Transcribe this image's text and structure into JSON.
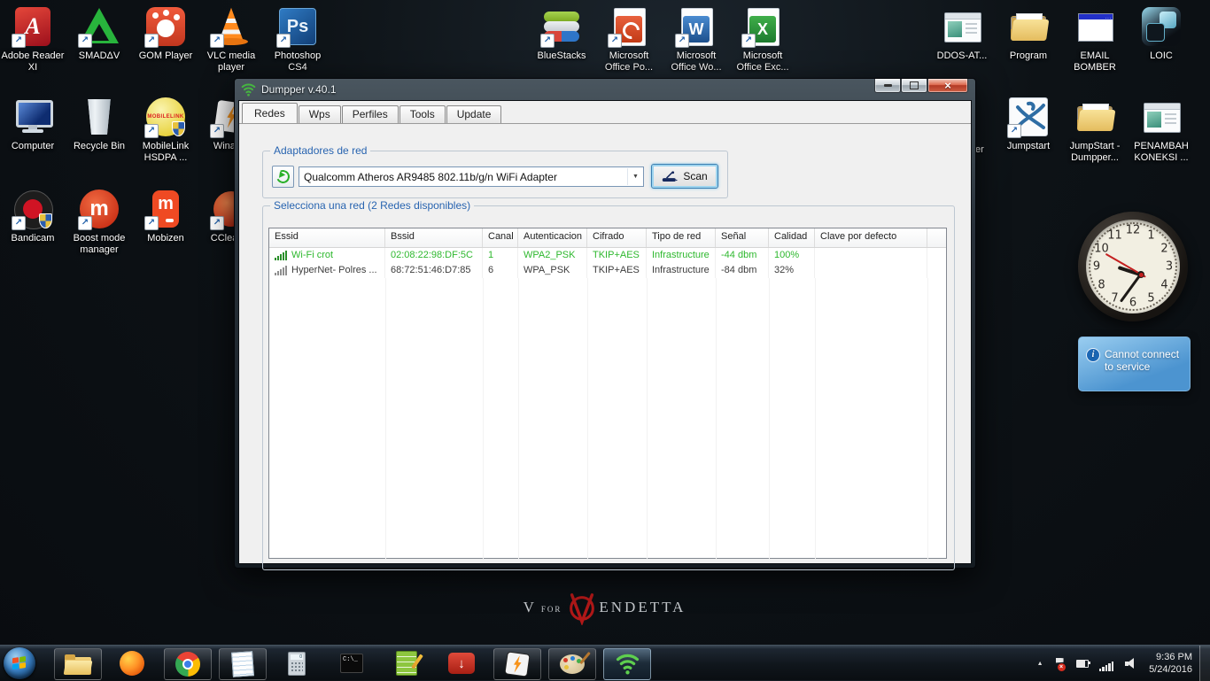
{
  "icons": {
    "shortcut_arrow": "↗",
    "adobe_glyph": "A",
    "photoshop_glyph": "Ps",
    "word_glyph": "W",
    "excel_glyph": "X",
    "boost_glyph": "m",
    "mobizen_glyph": "m",
    "cmd_glyph": "C:\\_",
    "calc_zero": "0",
    "download_arrow": "↓",
    "dropdown_arrow": "▼",
    "tray_expand": "▲",
    "info": "i",
    "close": "×",
    "email_dots": "...",
    "mobilelink_text": "MOBILELINK"
  },
  "desktop": {
    "icons": [
      {
        "label": "Adobe Reader XI"
      },
      {
        "label": "SMADΔV"
      },
      {
        "label": "GOM Player"
      },
      {
        "label": "VLC media player"
      },
      {
        "label": "Photoshop CS4"
      },
      {
        "label": "BlueStacks"
      },
      {
        "label": "Microsoft Office Po..."
      },
      {
        "label": "Microsoft Office Wo..."
      },
      {
        "label": "Microsoft Office Exc..."
      },
      {
        "label": "DDOS-AT..."
      },
      {
        "label": "Program"
      },
      {
        "label": "EMAIL BOMBER"
      },
      {
        "label": "LOIC"
      },
      {
        "label": "Computer"
      },
      {
        "label": "Recycle Bin"
      },
      {
        "label": "MobileLink HSDPA ..."
      },
      {
        "label": "Winamp"
      },
      {
        "label": "Jumpstart"
      },
      {
        "label": "JumpStart - Dumpper..."
      },
      {
        "label": "PENAMBAH KONEKSI ..."
      },
      {
        "label": "Bandicam"
      },
      {
        "label": "Boost mode manager"
      },
      {
        "label": "Mobizen"
      },
      {
        "label": "CCleaner"
      }
    ],
    "partial_label": "er",
    "vendetta": {
      "v": "V",
      "for": "FOR",
      "rest": "ENDETTA"
    }
  },
  "window": {
    "title": "Dumpper v.40.1",
    "tabs": [
      "Redes",
      "Wps",
      "Perfiles",
      "Tools",
      "Update"
    ],
    "adapters": {
      "group_label": "Adaptadores de red",
      "selected_adapter": "Qualcomm Atheros AR9485 802.11b/g/n WiFi Adapter",
      "scan_label": "Scan"
    },
    "networks": {
      "group_label": "Selecciona una red (2 Redes disponibles)",
      "columns": [
        "Essid",
        "Bssid",
        "Canal",
        "Autenticacion",
        "Cifrado",
        "Tipo de red",
        "Señal",
        "Calidad",
        "Clave por defecto"
      ],
      "rows": [
        {
          "essid": "Wi-Fi crot",
          "bssid": "02:08:22:98:DF:5C",
          "canal": "1",
          "autenticacion": "WPA2_PSK",
          "cifrado": "TKIP+AES",
          "tipo_de_red": "Infrastructure",
          "senal": "-44 dbm",
          "calidad": "100%",
          "clave": ""
        },
        {
          "essid": "HyperNet- Polres ...",
          "bssid": "68:72:51:46:D7:85",
          "canal": "6",
          "autenticacion": "WPA_PSK",
          "cifrado": "TKIP+AES",
          "tipo_de_red": "Infrastructure",
          "senal": "-84 dbm",
          "calidad": "32%",
          "clave": ""
        }
      ]
    }
  },
  "gadgets": {
    "clock": {
      "numbers": [
        "12",
        "1",
        "2",
        "3",
        "4",
        "5",
        "6",
        "7",
        "8",
        "9",
        "10",
        "11"
      ]
    },
    "notification": {
      "text": "Cannot connect to service"
    }
  },
  "taskbar": {
    "tray": {
      "time": "9:36 PM",
      "date": "5/24/2016"
    }
  },
  "colors": {
    "row_highlight_green": "#2eb82e",
    "group_label_blue": "#2864b0",
    "wifi_green": "#46b441",
    "notification_blue": "#4c94d0"
  }
}
